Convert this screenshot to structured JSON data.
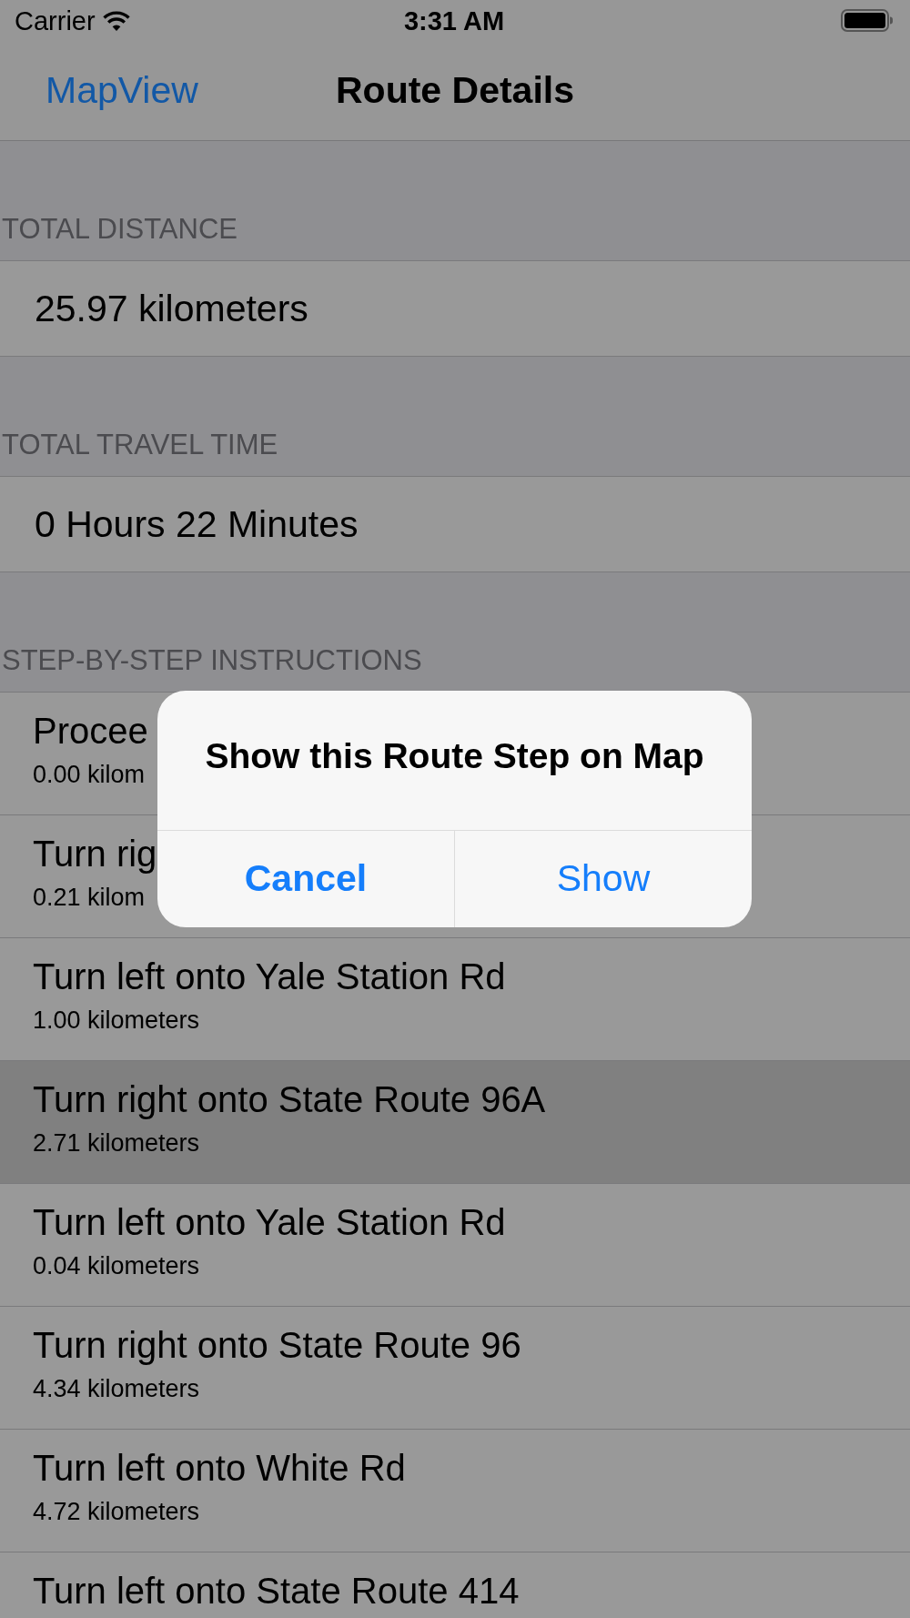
{
  "status_bar": {
    "carrier": "Carrier",
    "time": "3:31 AM"
  },
  "nav_bar": {
    "back_button": "MapView",
    "title": "Route Details"
  },
  "sections": [
    {
      "header": "TOTAL DISTANCE",
      "rows": [
        {
          "kind": "value",
          "title": "25.97 kilometers"
        }
      ]
    },
    {
      "header": "TOTAL TRAVEL TIME",
      "rows": [
        {
          "kind": "value",
          "title": "0 Hours 22 Minutes"
        }
      ]
    },
    {
      "header": "STEP-BY-STEP INSTRUCTIONS",
      "rows": [
        {
          "kind": "step",
          "title": "Procee",
          "subtitle": "0.00 kilom",
          "selected": false
        },
        {
          "kind": "step",
          "title": "Turn rig",
          "subtitle": "0.21 kilom",
          "selected": false
        },
        {
          "kind": "step",
          "title": "Turn left onto Yale Station Rd",
          "subtitle": "1.00 kilometers",
          "selected": false
        },
        {
          "kind": "step",
          "title": "Turn right onto State Route 96A",
          "subtitle": "2.71 kilometers",
          "selected": true
        },
        {
          "kind": "step",
          "title": "Turn left onto Yale Station Rd",
          "subtitle": "0.04 kilometers",
          "selected": false
        },
        {
          "kind": "step",
          "title": "Turn right onto State Route 96",
          "subtitle": "4.34 kilometers",
          "selected": false
        },
        {
          "kind": "step",
          "title": "Turn left onto White Rd",
          "subtitle": "4.72 kilometers",
          "selected": false
        },
        {
          "kind": "step",
          "title": "Turn left onto State Route 414",
          "selected": false
        }
      ]
    }
  ],
  "alert": {
    "title": "Show this Route Step on Map",
    "buttons": [
      {
        "label": "Cancel",
        "kind": "cancel"
      },
      {
        "label": "Show",
        "kind": "default"
      }
    ]
  }
}
